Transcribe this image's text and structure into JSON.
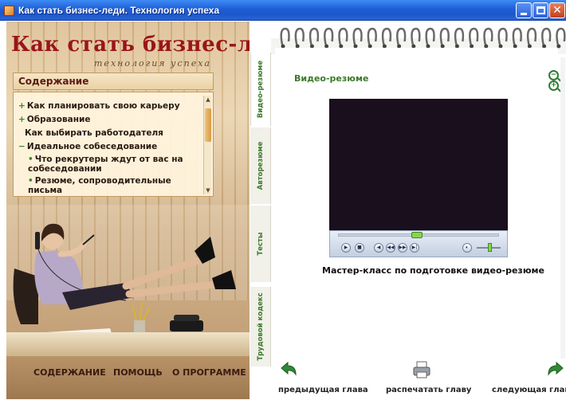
{
  "window": {
    "title": "Как стать бизнес-леди. Технология успеха",
    "buttons": {
      "minimize_icon": "minimize-icon",
      "maximize_icon": "maximize-icon",
      "close_glyph": "✕"
    }
  },
  "brand": {
    "title": "Как стать бизнес-леди",
    "subtitle": "технология успеха"
  },
  "toc": {
    "header": "Содержание",
    "items": [
      {
        "marker": "+",
        "label": "Как планировать свою карьеру"
      },
      {
        "marker": "+",
        "label": "Образование"
      },
      {
        "marker": "",
        "label": "Как выбирать работодателя"
      },
      {
        "marker": "−",
        "label": "Идеальное собеседование"
      },
      {
        "marker": "•",
        "label": "Что рекрутеры ждут от вас на собеседовании"
      },
      {
        "marker": "•",
        "label": "Резюме, сопроводительные письма"
      }
    ]
  },
  "bottom_nav": {
    "contents": "СОДЕРЖАНИЕ",
    "help": "ПОМОЩЬ",
    "about": "О ПРОГРАММЕ"
  },
  "tabs": [
    {
      "label": "Видео-резюме",
      "active": true
    },
    {
      "label": "Авторезюме",
      "active": false
    },
    {
      "label": "Тесты",
      "active": false
    },
    {
      "label": "Трудовой кодекс",
      "active": false
    }
  ],
  "page": {
    "heading": "Видео-резюме",
    "caption": "Мастер-класс по подготовке видео-резюме"
  },
  "player": {
    "buttons": [
      "▶",
      "■",
      "◀",
      "◀◀",
      "▶▶",
      "▶|"
    ],
    "volume_icon": "speaker-icon",
    "volume_level": 0.5,
    "seek_position": 0.48
  },
  "actions": {
    "prev": "предыдущая глава",
    "print": "распечатать главу",
    "next": "следующая глава"
  },
  "colors": {
    "accent_green": "#3c7a2a",
    "brand_red": "#9b1419"
  }
}
